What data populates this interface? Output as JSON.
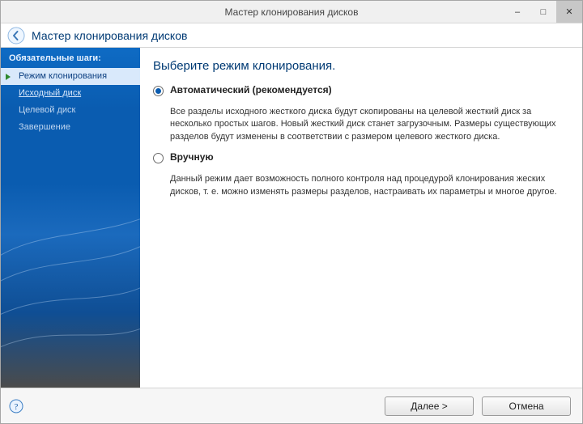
{
  "window": {
    "title": "Мастер клонирования дисков"
  },
  "header": {
    "title": "Мастер клонирования дисков"
  },
  "sidebar": {
    "heading": "Обязательные шаги:",
    "steps": [
      {
        "label": "Режим клонирования",
        "state": "active"
      },
      {
        "label": "Исходный диск",
        "state": "link"
      },
      {
        "label": "Целевой диск",
        "state": "dim"
      },
      {
        "label": "Завершение",
        "state": "dim"
      }
    ]
  },
  "main": {
    "heading": "Выберите режим клонирования.",
    "options": [
      {
        "id": "auto",
        "label": "Автоматический (рекомендуется)",
        "checked": true,
        "desc": "Все разделы исходного жесткого диска будут скопированы на целевой жесткий диск за несколько простых шагов. Новый жесткий диск станет загрузочным. Размеры существующих разделов будут изменены в соответствии с размером целевого жесткого диска."
      },
      {
        "id": "manual",
        "label": "Вручную",
        "checked": false,
        "desc": "Данный режим дает возможность полного контроля над процедурой клонирования жеских дисков, т. е. можно изменять размеры разделов, настраивать их параметры и многое другое."
      }
    ]
  },
  "footer": {
    "next": "Далее >",
    "cancel": "Отмена"
  },
  "icons": {
    "minimize": "–",
    "maximize": "□",
    "close": "✕"
  }
}
